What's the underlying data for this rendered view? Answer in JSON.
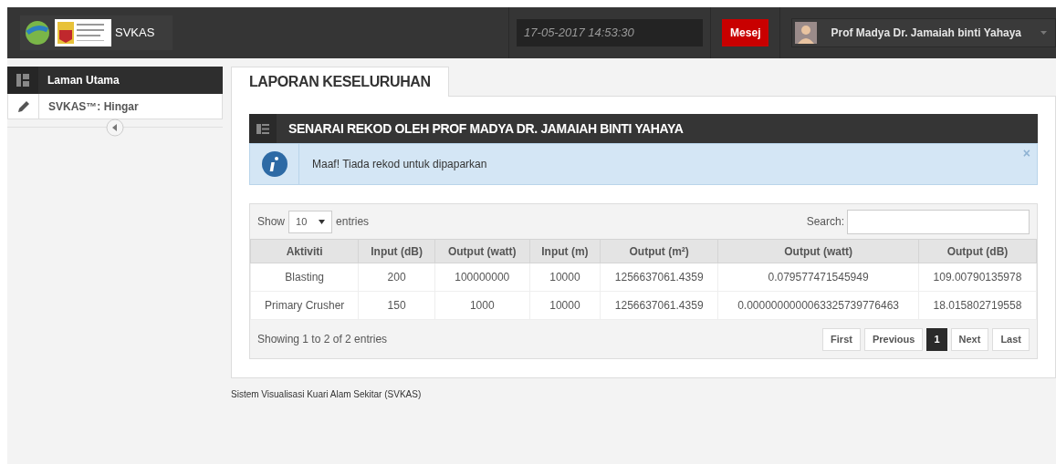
{
  "header": {
    "app_name": "SVKAS",
    "datetime": "17-05-2017 14:53:30",
    "message_button": "Mesej",
    "user_name": "Prof Madya Dr. Jamaiah binti Yahaya"
  },
  "sidebar": {
    "items": [
      {
        "label": "Laman Utama",
        "selected": true
      },
      {
        "label": "SVKAS™: Hingar",
        "selected": false
      }
    ]
  },
  "page_tab": "LAPORAN KESELURUHAN",
  "panel": {
    "title": "SENARAI REKOD OLEH PROF MADYA DR. JAMAIAH BINTI YAHAYA",
    "alert": {
      "message": "Maaf! Tiada rekod untuk dipaparkan",
      "close": "×"
    },
    "table": {
      "show_label": "Show",
      "page_size": "10",
      "entries_label": "entries",
      "search_label": "Search:",
      "columns": [
        "Aktiviti",
        "Input (dB)",
        "Output (watt)",
        "Input (m)",
        "Output (m²)",
        "Output (watt)",
        "Output (dB)"
      ],
      "rows": [
        [
          "Blasting",
          "200",
          "100000000",
          "10000",
          "1256637061.4359",
          "0.079577471545949",
          "109.00790135978"
        ],
        [
          "Primary Crusher",
          "150",
          "1000",
          "10000",
          "1256637061.4359",
          "0.0000000000063325739776463",
          "18.015802719558"
        ]
      ],
      "info": "Showing 1 to 2 of 2 entries",
      "pagination": [
        {
          "label": "First",
          "selected": false
        },
        {
          "label": "Previous",
          "selected": false
        },
        {
          "label": "1",
          "selected": true
        },
        {
          "label": "Next",
          "selected": false
        },
        {
          "label": "Last",
          "selected": false
        }
      ]
    }
  },
  "footer": "Sistem Visualisasi Kuari Alam Sekitar (SVKAS)"
}
